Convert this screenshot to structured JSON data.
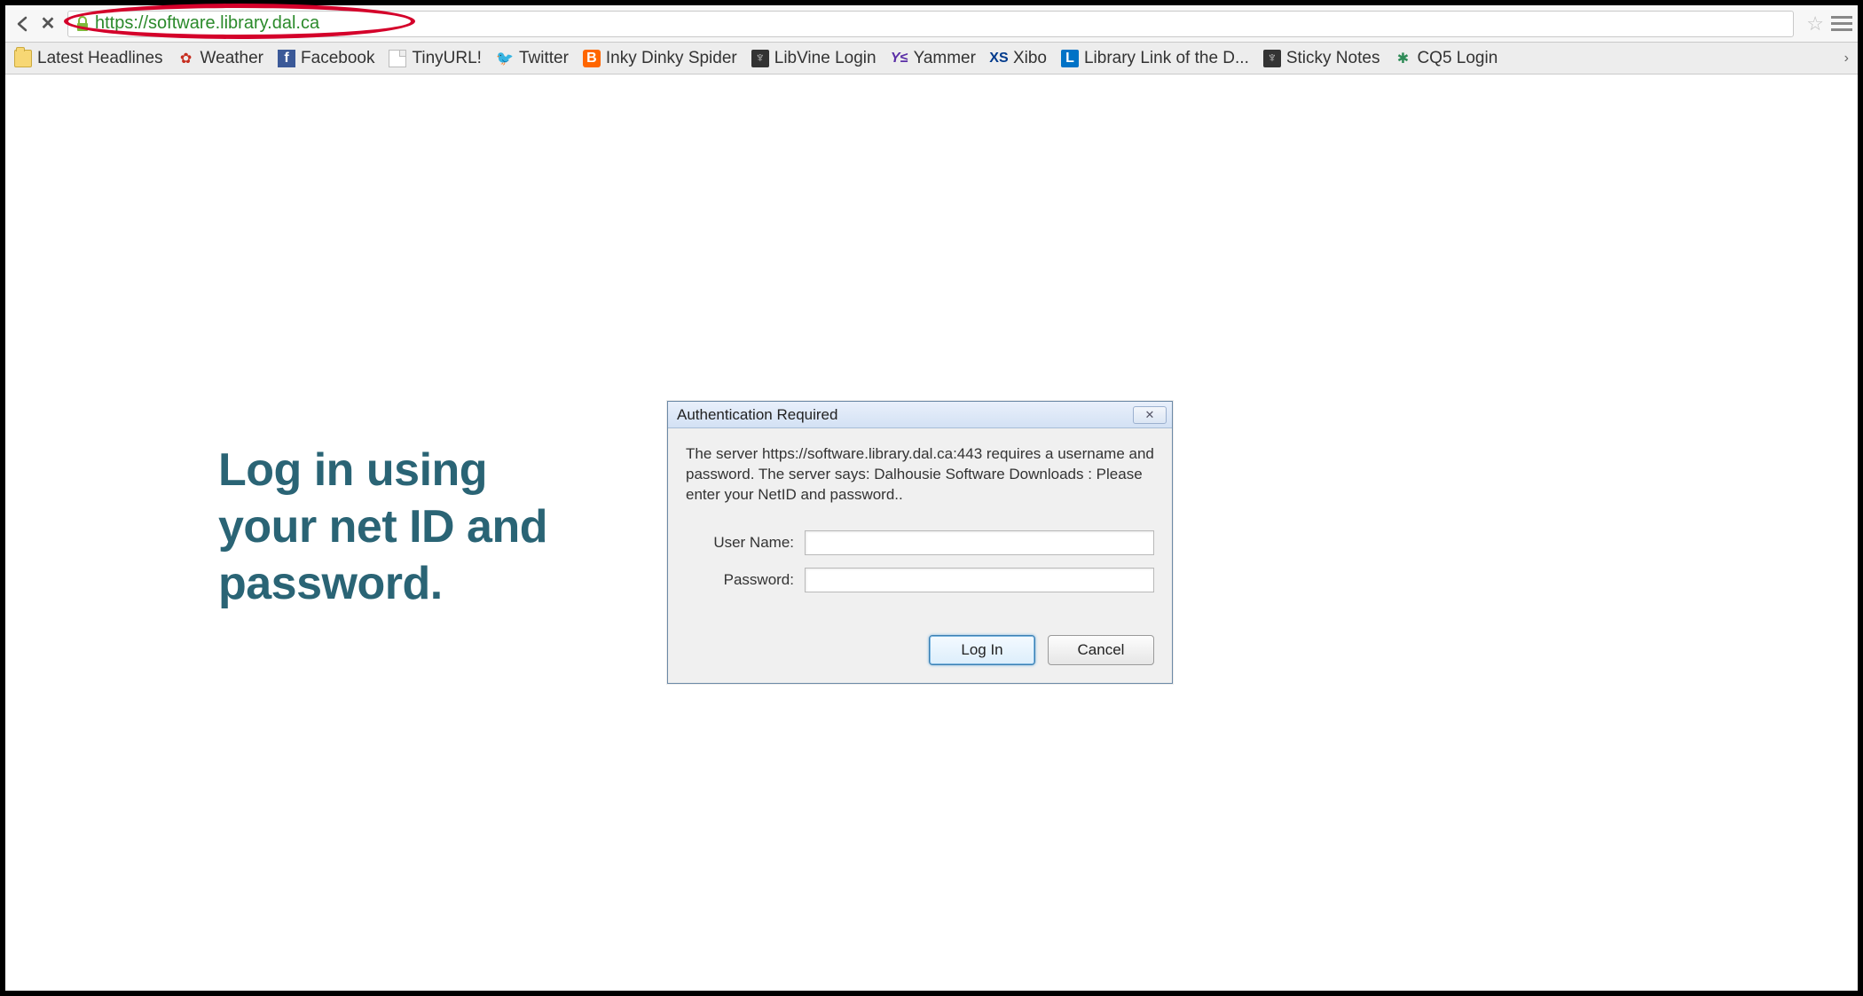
{
  "address_bar": {
    "url_prefix": "https",
    "url_rest": "://software.library.dal.ca"
  },
  "bookmarks": [
    {
      "label": "Latest Headlines",
      "icon": "folder-icon"
    },
    {
      "label": "Weather",
      "icon": "leaf-icon"
    },
    {
      "label": "Facebook",
      "icon": "facebook-icon"
    },
    {
      "label": "TinyURL!",
      "icon": "page-icon"
    },
    {
      "label": "Twitter",
      "icon": "twitter-icon"
    },
    {
      "label": "Inky Dinky Spider",
      "icon": "blogger-icon"
    },
    {
      "label": "LibVine Login",
      "icon": "shield-icon"
    },
    {
      "label": "Yammer",
      "icon": "yammer-icon"
    },
    {
      "label": "Xibo",
      "icon": "xs-icon"
    },
    {
      "label": "Library Link of the D...",
      "icon": "ll-icon"
    },
    {
      "label": "Sticky Notes",
      "icon": "shield-icon"
    },
    {
      "label": "CQ5 Login",
      "icon": "cq-icon"
    }
  ],
  "instruction": {
    "line1": "Log in using",
    "line2": "your net ID and",
    "line3": "password."
  },
  "dialog": {
    "title": "Authentication Required",
    "message": "The server https://software.library.dal.ca:443 requires a username and password. The server says: Dalhousie Software Downloads : Please enter your NetID and password..",
    "username_label": "User Name:",
    "password_label": "Password:",
    "username_value": "",
    "password_value": "",
    "login_label": "Log In",
    "cancel_label": "Cancel"
  }
}
